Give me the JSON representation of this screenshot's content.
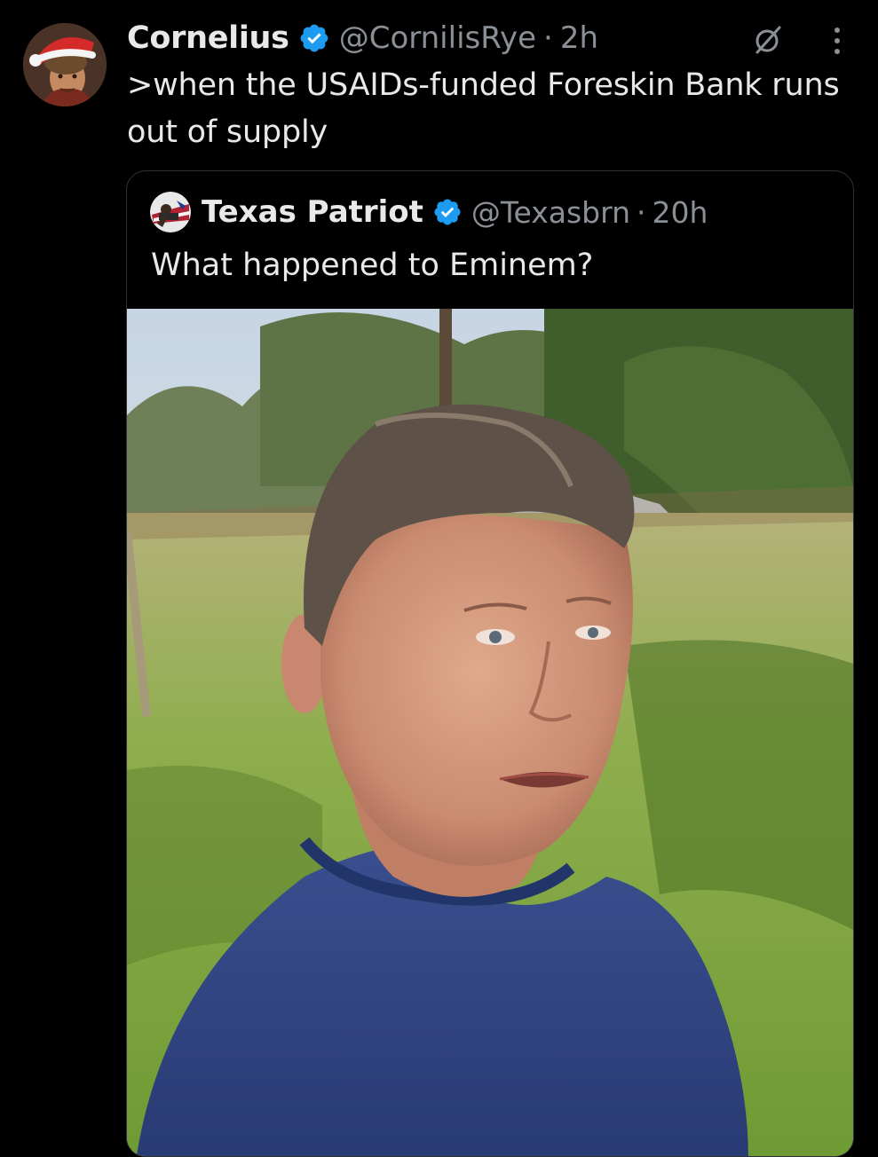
{
  "post": {
    "author": {
      "display_name": "Cornelius",
      "handle": "@CornilisRye",
      "separator": "·",
      "time": "2h",
      "verified": true
    },
    "text": ">when the USAIDs-funded Foreskin Bank runs out of supply",
    "icons": {
      "avatar": "avatar-santa-hat",
      "verified": "verified-badge-icon",
      "grok": "grok-slash-circle-icon",
      "more": "more-vertical-icon"
    }
  },
  "quoted_post": {
    "author": {
      "display_name": "Texas Patriot",
      "handle": "@Texasbrn",
      "separator": "·",
      "time": "20h",
      "verified": true
    },
    "text": "What happened to Eminem?",
    "media": "photo of a short-haired person in a blue t-shirt outdoors in a sunny park with trees"
  },
  "colors": {
    "background": "#000000",
    "primary_text": "#e7e9ea",
    "secondary_text": "#8b9096",
    "verified_blue": "#1d9bf0",
    "card_border": "#2f3336"
  }
}
